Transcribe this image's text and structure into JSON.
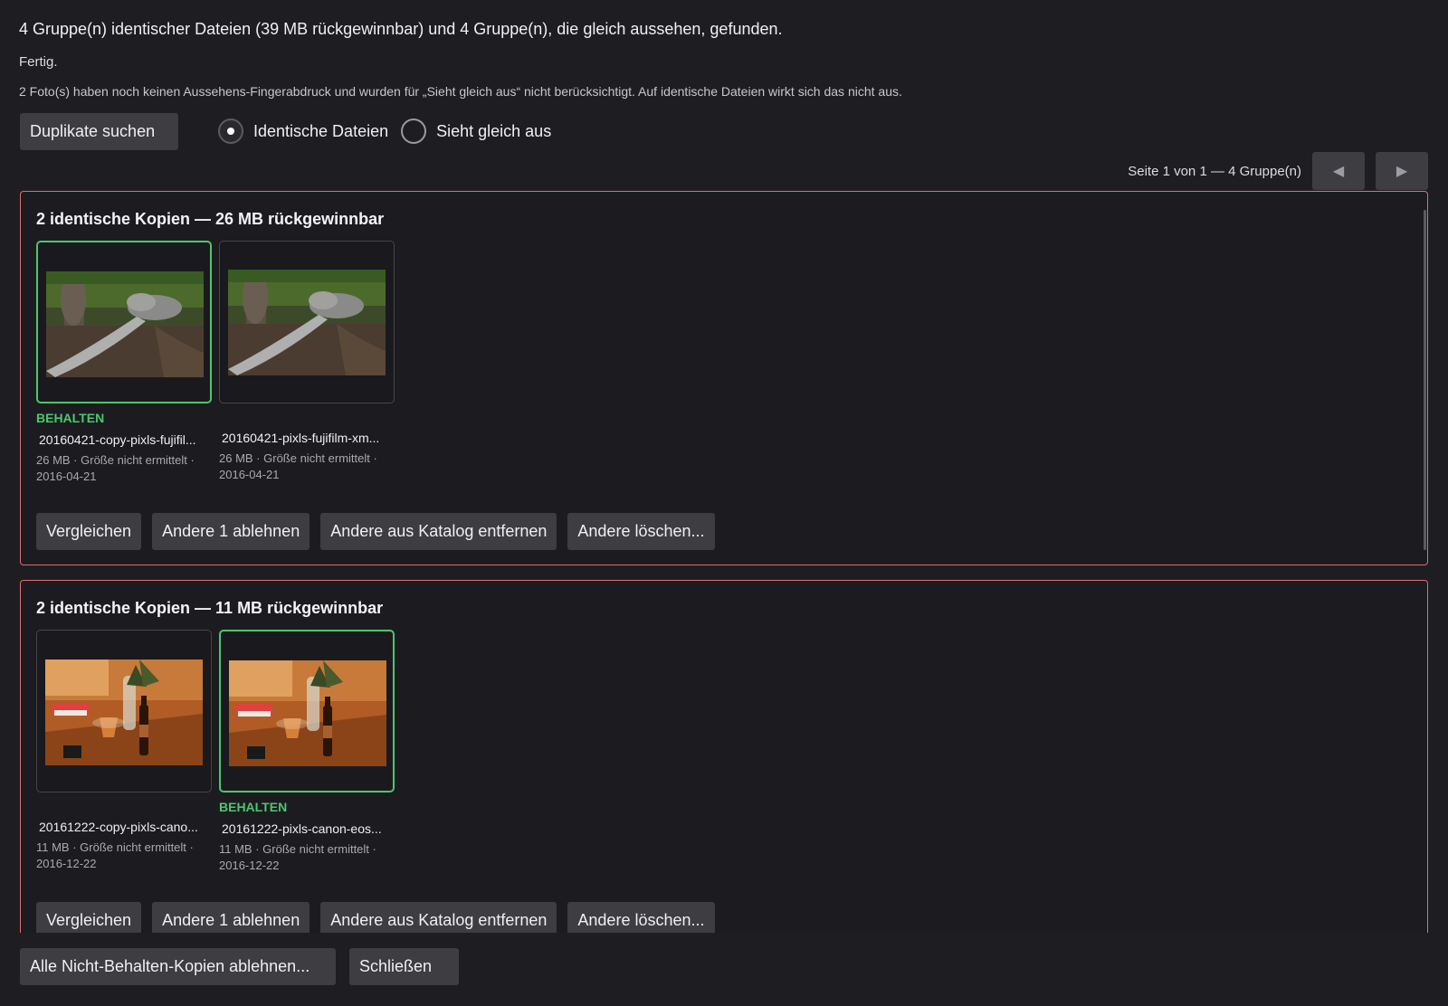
{
  "summary": "4 Gruppe(n) identischer Dateien (39 MB rückgewinnbar) und 4 Gruppe(n), die gleich aussehen, gefunden.",
  "status": "Fertig.",
  "note": "2 Foto(s) haben noch keinen Aussehens-Fingerabdruck und wurden für „Sieht gleich aus“ nicht berücksichtigt. Auf identische Dateien wirkt sich das nicht aus.",
  "search_button": "Duplikate suchen",
  "mode": {
    "identical_label": "Identische Dateien",
    "similar_label": "Sieht gleich aus",
    "selected": "identical"
  },
  "pager": {
    "text": "Seite 1 von 1 — 4 Gruppe(n)",
    "prev_icon": "◀",
    "next_icon": "▶"
  },
  "groups": [
    {
      "title": "2 identische Kopien — 26 MB rückgewinnbar",
      "files": [
        {
          "keep_label": "BEHALTEN",
          "name": "20160421-copy-pixls-fujifil...",
          "meta1": "26 MB · Größe nicht ermittelt ·",
          "meta2": "2016-04-21",
          "keep": true
        },
        {
          "keep_label": "",
          "name": "20160421-pixls-fujifilm-xm...",
          "meta1": "26 MB · Größe nicht ermittelt ·",
          "meta2": "2016-04-21",
          "keep": false
        }
      ],
      "actions": {
        "compare": "Vergleichen",
        "reject_others": "Andere 1 ablehnen",
        "remove_from_catalog": "Andere aus Katalog entfernen",
        "delete_others": "Andere löschen..."
      }
    },
    {
      "title": "2 identische Kopien — 11 MB rückgewinnbar",
      "files": [
        {
          "keep_label": "",
          "name": "20161222-copy-pixls-cano...",
          "meta1": "11 MB · Größe nicht ermittelt ·",
          "meta2": "2016-12-22",
          "keep": false
        },
        {
          "keep_label": "BEHALTEN",
          "name": "20161222-pixls-canon-eos...",
          "meta1": "11 MB · Größe nicht ermittelt ·",
          "meta2": "2016-12-22",
          "keep": true
        }
      ],
      "actions": {
        "compare": "Vergleichen",
        "reject_others": "Andere 1 ablehnen",
        "remove_from_catalog": "Andere aus Katalog entfernen",
        "delete_others": "Andere löschen..."
      }
    }
  ],
  "footer": {
    "reject_all": "Alle Nicht-Behalten-Kopien ablehnen...",
    "close": "Schließen"
  },
  "colors": {
    "group_border": "#e06c6c",
    "keep_green": "#4cc76e",
    "button_bg": "#3d3d42",
    "background": "#1e1e22"
  }
}
